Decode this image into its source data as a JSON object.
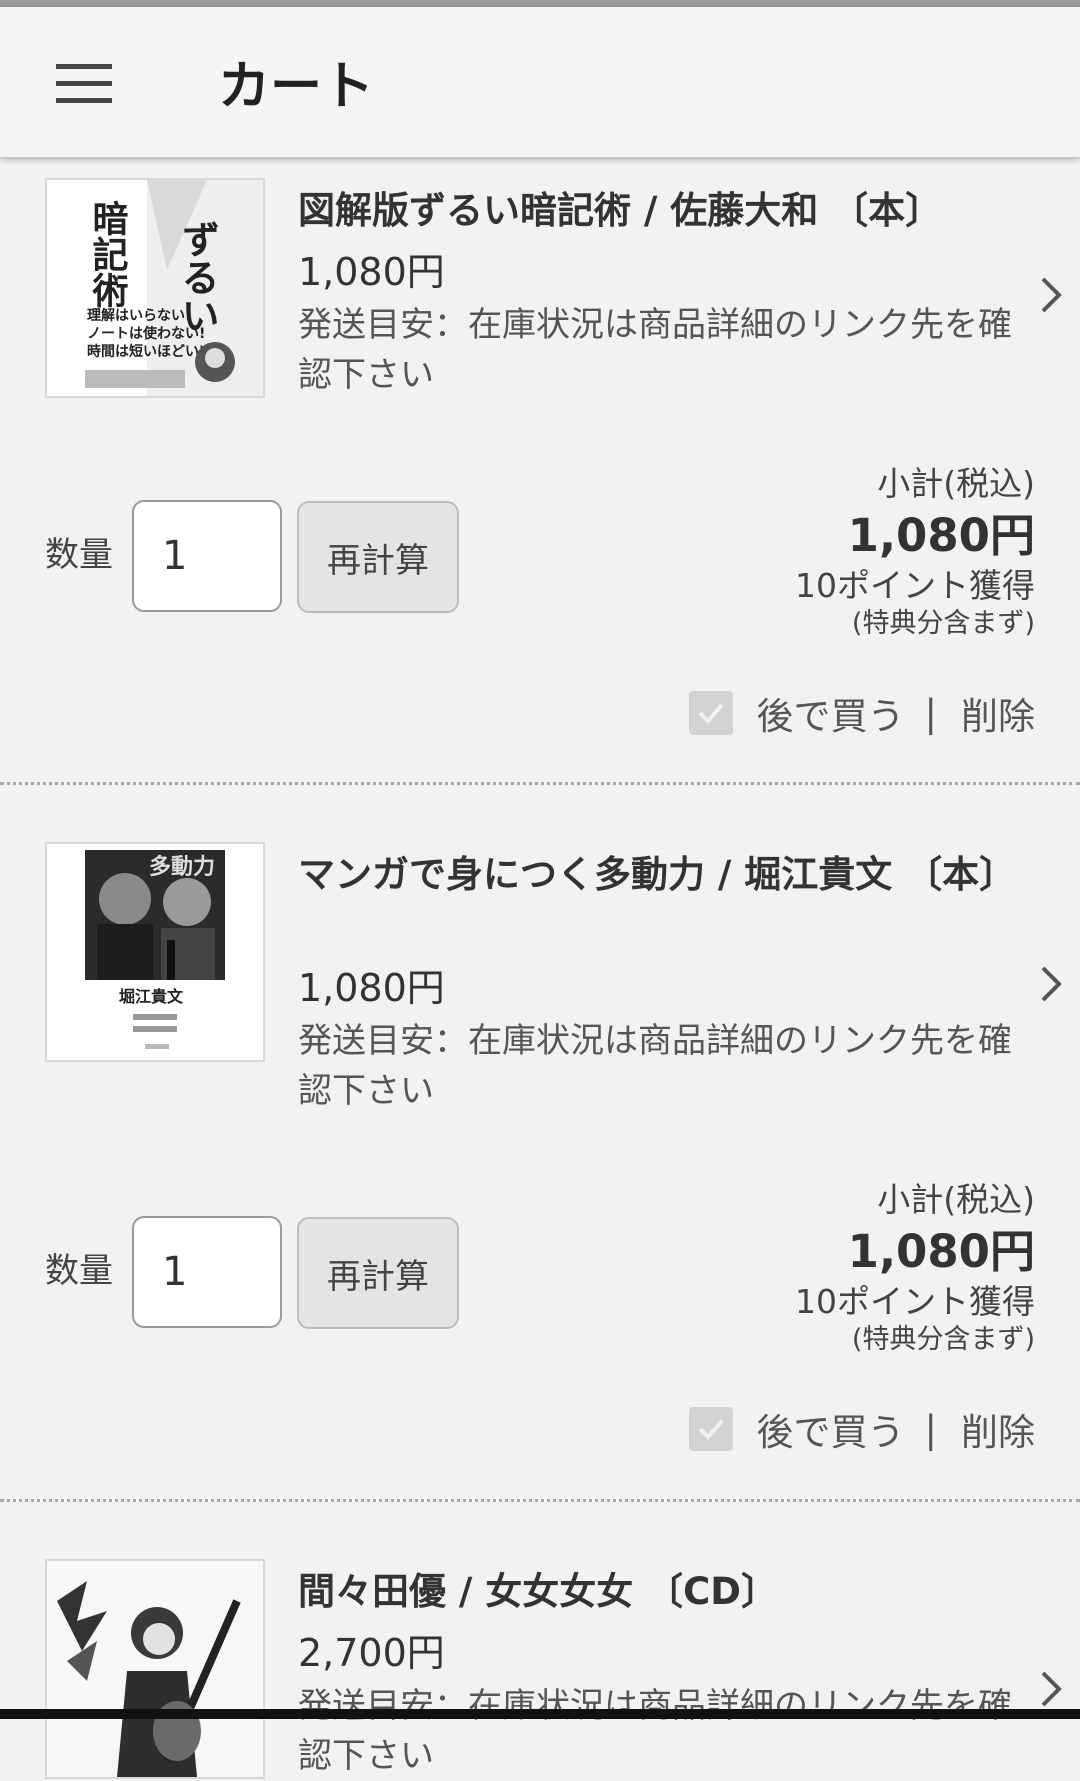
{
  "header": {
    "title": "カート",
    "menu_icon": "hamburger-menu-icon"
  },
  "labels": {
    "qty_label": "数量",
    "recalc_label": "再計算",
    "subtotal_label": "小計(税込)",
    "points_note": "(特典分含まず)",
    "later_label": "後で買う",
    "separator": "|",
    "delete_label": "削除"
  },
  "items": [
    {
      "title": "図解版ずるい暗記術 / 佐藤大和 〔本〕",
      "price": "1,080円",
      "shipping": "発送目安：在庫状況は商品詳細のリンク先を確認下さい",
      "quantity": "1",
      "subtotal": "1,080円",
      "points": "10ポイント獲得"
    },
    {
      "title": "マンガで身につく多動力 / 堀江貴文 〔本〕",
      "price": "1,080円",
      "shipping": "発送目安：在庫状況は商品詳細のリンク先を確認下さい",
      "quantity": "1",
      "subtotal": "1,080円",
      "points": "10ポイント獲得"
    },
    {
      "title": "間々田優 / 女女女女 〔CD〕",
      "price": "2,700円",
      "shipping": "発送目安：在庫状況は商品詳細のリンク先を確認下さい"
    }
  ],
  "cover_text": {
    "item0": [
      "ずるい",
      "暗記術",
      "理解はいらない!",
      "ノートは使わない!",
      "時間は短いほどいい!"
    ],
    "item1": [
      "多動力",
      "堀江貴文"
    ]
  }
}
